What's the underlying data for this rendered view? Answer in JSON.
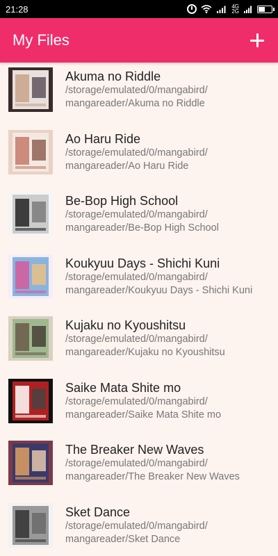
{
  "status_bar": {
    "time": "21:28",
    "net_top": "4G",
    "net_bottom": "2G"
  },
  "app_bar": {
    "title": "My Files",
    "add_icon": "plus-icon"
  },
  "colors": {
    "app_bar": "#ef2d6b",
    "background": "#fdf3ef",
    "title_text": "#222222",
    "path_text": "#777777"
  },
  "files": [
    {
      "title": "Akuma no Riddle",
      "path_line1": "/storage/emulated/0/mangabird/",
      "path_line2": "mangareader/Akuma no Riddle",
      "thumb": "manga-cover"
    },
    {
      "title": "Ao Haru Ride",
      "path_line1": "/storage/emulated/0/mangabird/",
      "path_line2": "mangareader/Ao Haru Ride",
      "thumb": "manga-cover"
    },
    {
      "title": "Be-Bop High School",
      "path_line1": "/storage/emulated/0/mangabird/",
      "path_line2": "mangareader/Be-Bop High School",
      "thumb": "manga-cover"
    },
    {
      "title": "Koukyuu Days - Shichi Kuni",
      "path_line1": "/storage/emulated/0/mangabird/",
      "path_line2": "mangareader/Koukyuu Days - Shichi Kuni",
      "thumb": "manga-cover"
    },
    {
      "title": "Kujaku no Kyoushitsu",
      "path_line1": "/storage/emulated/0/mangabird/",
      "path_line2": "mangareader/Kujaku no Kyoushitsu",
      "thumb": "manga-cover"
    },
    {
      "title": "Saike Mata Shite mo",
      "path_line1": "/storage/emulated/0/mangabird/",
      "path_line2": "mangareader/Saike Mata Shite mo",
      "thumb": "manga-cover"
    },
    {
      "title": "The Breaker New Waves",
      "path_line1": "/storage/emulated/0/mangabird/",
      "path_line2": "mangareader/The Breaker New Waves",
      "thumb": "manga-cover"
    },
    {
      "title": "Sket Dance",
      "path_line1": "/storage/emulated/0/mangabird/",
      "path_line2": "mangareader/Sket Dance",
      "thumb": "manga-cover"
    }
  ]
}
